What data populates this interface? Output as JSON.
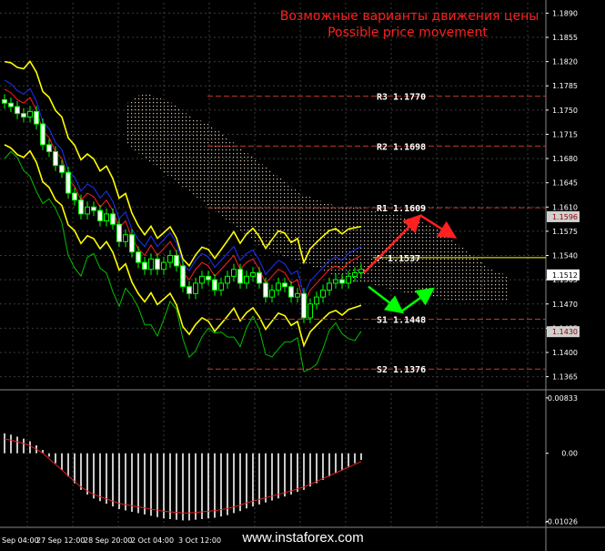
{
  "chart_data": {
    "type": "candlestick",
    "title": "Возможные варианты движения цены",
    "subtitle": "Possible price movement",
    "watermark": "www.instaforex.com",
    "price_axis": {
      "ticks": [
        "1.1890",
        "1.1855",
        "1.1820",
        "1.1785",
        "1.1750",
        "1.1715",
        "1.1680",
        "1.1645",
        "1.1610",
        "1.1575",
        "1.1540",
        "1.1505",
        "1.1470",
        "1.1435",
        "1.1400",
        "1.1365"
      ],
      "ylim": [
        1.135,
        1.1905
      ]
    },
    "price_markers": [
      {
        "label": "1.1596",
        "value": 1.1596,
        "color": "#d0d0d0",
        "text_color": "#8b0000"
      },
      {
        "label": "1.1512",
        "value": 1.1512,
        "color": "#ffffff",
        "text_color": "#000000"
      },
      {
        "label": "1.1430",
        "value": 1.143,
        "color": "#d0d0d0",
        "text_color": "#8b0000"
      }
    ],
    "macd_axis": {
      "ticks": [
        "0.00833",
        "0.00",
        "-0.01026"
      ],
      "ylim": [
        -0.011,
        0.009
      ]
    },
    "time_axis": {
      "ticks": [
        "Sep 04:00",
        "27 Sep 12:00",
        "28 Sep 20:00",
        "2 Oct 04:00",
        "3 Oct 12:00"
      ]
    },
    "levels": [
      {
        "name": "R3",
        "value": 1.177,
        "label": "R3  1.1770",
        "color": "#c0392b"
      },
      {
        "name": "R2",
        "value": 1.1698,
        "label": "R2  1.1698",
        "color": "#c0392b"
      },
      {
        "name": "R1",
        "value": 1.1609,
        "label": "R1  1.1609",
        "color": "#c0392b"
      },
      {
        "name": "P",
        "value": 1.1537,
        "label": "P  1.1537",
        "color": "#ffff00"
      },
      {
        "name": "S1",
        "value": 1.1448,
        "label": "S1  1.1448",
        "color": "#c0392b"
      },
      {
        "name": "S2",
        "value": 1.1376,
        "label": "S2  1.1376",
        "color": "#c0392b"
      }
    ],
    "bar_count": 57,
    "candles_close": [
      1.176,
      1.1755,
      1.1745,
      1.174,
      1.1748,
      1.173,
      1.17,
      1.169,
      1.167,
      1.166,
      1.163,
      1.162,
      1.16,
      1.161,
      1.1605,
      1.159,
      1.16,
      1.1585,
      1.156,
      1.157,
      1.1545,
      1.153,
      1.152,
      1.1535,
      1.152,
      1.153,
      1.154,
      1.1525,
      1.1495,
      1.1485,
      1.15,
      1.151,
      1.1505,
      1.149,
      1.15,
      1.151,
      1.152,
      1.15,
      1.151,
      1.1515,
      1.15,
      1.148,
      1.149,
      1.15,
      1.1495,
      1.148,
      1.1485,
      1.145,
      1.147,
      1.148,
      1.149,
      1.15,
      1.1505,
      1.15,
      1.151,
      1.1515,
      1.152
    ],
    "forecast": {
      "up_path": [
        [
          1.1537
        ],
        [
          1.16
        ],
        [
          1.157
        ]
      ],
      "down_path": [
        [
          1.15
        ],
        [
          1.147
        ],
        [
          1.1495
        ]
      ]
    },
    "macd_hist": [
      0.003,
      0.0028,
      0.0025,
      0.0022,
      0.0018,
      0.0012,
      0.0005,
      -0.0005,
      -0.0015,
      -0.0025,
      -0.0035,
      -0.0045,
      -0.0055,
      -0.0062,
      -0.0068,
      -0.0072,
      -0.0076,
      -0.008,
      -0.0084,
      -0.0086,
      -0.0088,
      -0.009,
      -0.0092,
      -0.0094,
      -0.0096,
      -0.0098,
      -0.0099,
      -0.01,
      -0.0101,
      -0.0101,
      -0.01,
      -0.0099,
      -0.0098,
      -0.0097,
      -0.0095,
      -0.0093,
      -0.009,
      -0.0087,
      -0.0083,
      -0.008,
      -0.0077,
      -0.0074,
      -0.0071,
      -0.0068,
      -0.0065,
      -0.0062,
      -0.0058,
      -0.0055,
      -0.005,
      -0.0045,
      -0.004,
      -0.0035,
      -0.003,
      -0.0025,
      -0.002,
      -0.0015,
      -0.001
    ]
  }
}
